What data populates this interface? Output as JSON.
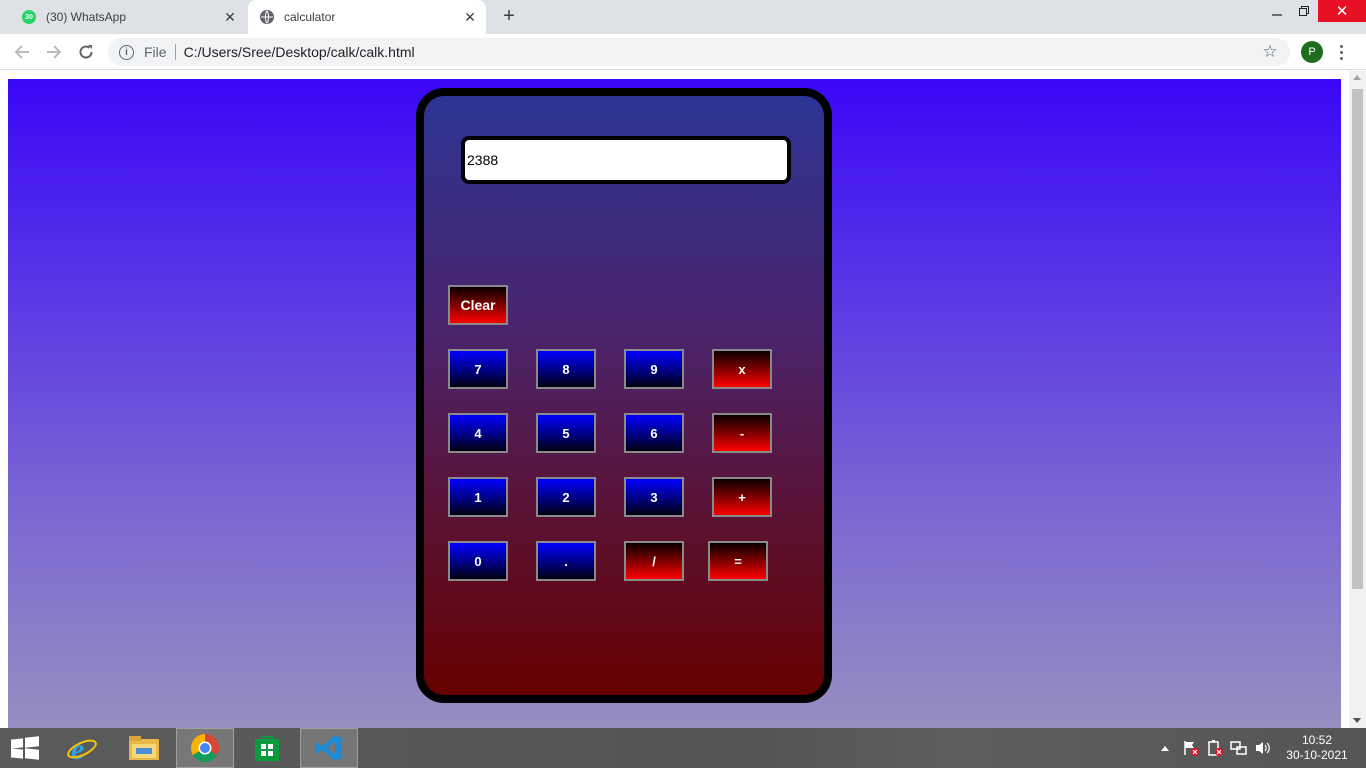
{
  "browser": {
    "tabs": [
      {
        "title": "(30) WhatsApp",
        "badge": "30",
        "icon": "whatsapp-icon"
      },
      {
        "title": "calculator",
        "icon": "globe-icon"
      }
    ],
    "omnibox": {
      "scheme_label": "File",
      "url": "C:/Users/Sree/Desktop/calk/calk.html"
    },
    "profile_initial": "P"
  },
  "calculator": {
    "display_value": "2388",
    "clear_label": "Clear",
    "keys": {
      "k7": "7",
      "k8": "8",
      "k9": "9",
      "mul": "x",
      "k4": "4",
      "k5": "5",
      "k6": "6",
      "sub": "-",
      "k1": "1",
      "k2": "2",
      "k3": "3",
      "add": "+",
      "k0": "0",
      "dot": ".",
      "div": "/",
      "eq": "="
    }
  },
  "taskbar": {
    "apps": [
      "internet-explorer",
      "file-explorer",
      "chrome",
      "store",
      "vscode"
    ],
    "clock": {
      "time": "10:52",
      "date": "30-10-2021"
    }
  },
  "colors": {
    "page_gradient_top": "#3a06f7",
    "page_gradient_bottom": "#968fc0",
    "number_key": "#0000ff",
    "operator_key": "#ff0000",
    "calculator_border": "#000000"
  }
}
